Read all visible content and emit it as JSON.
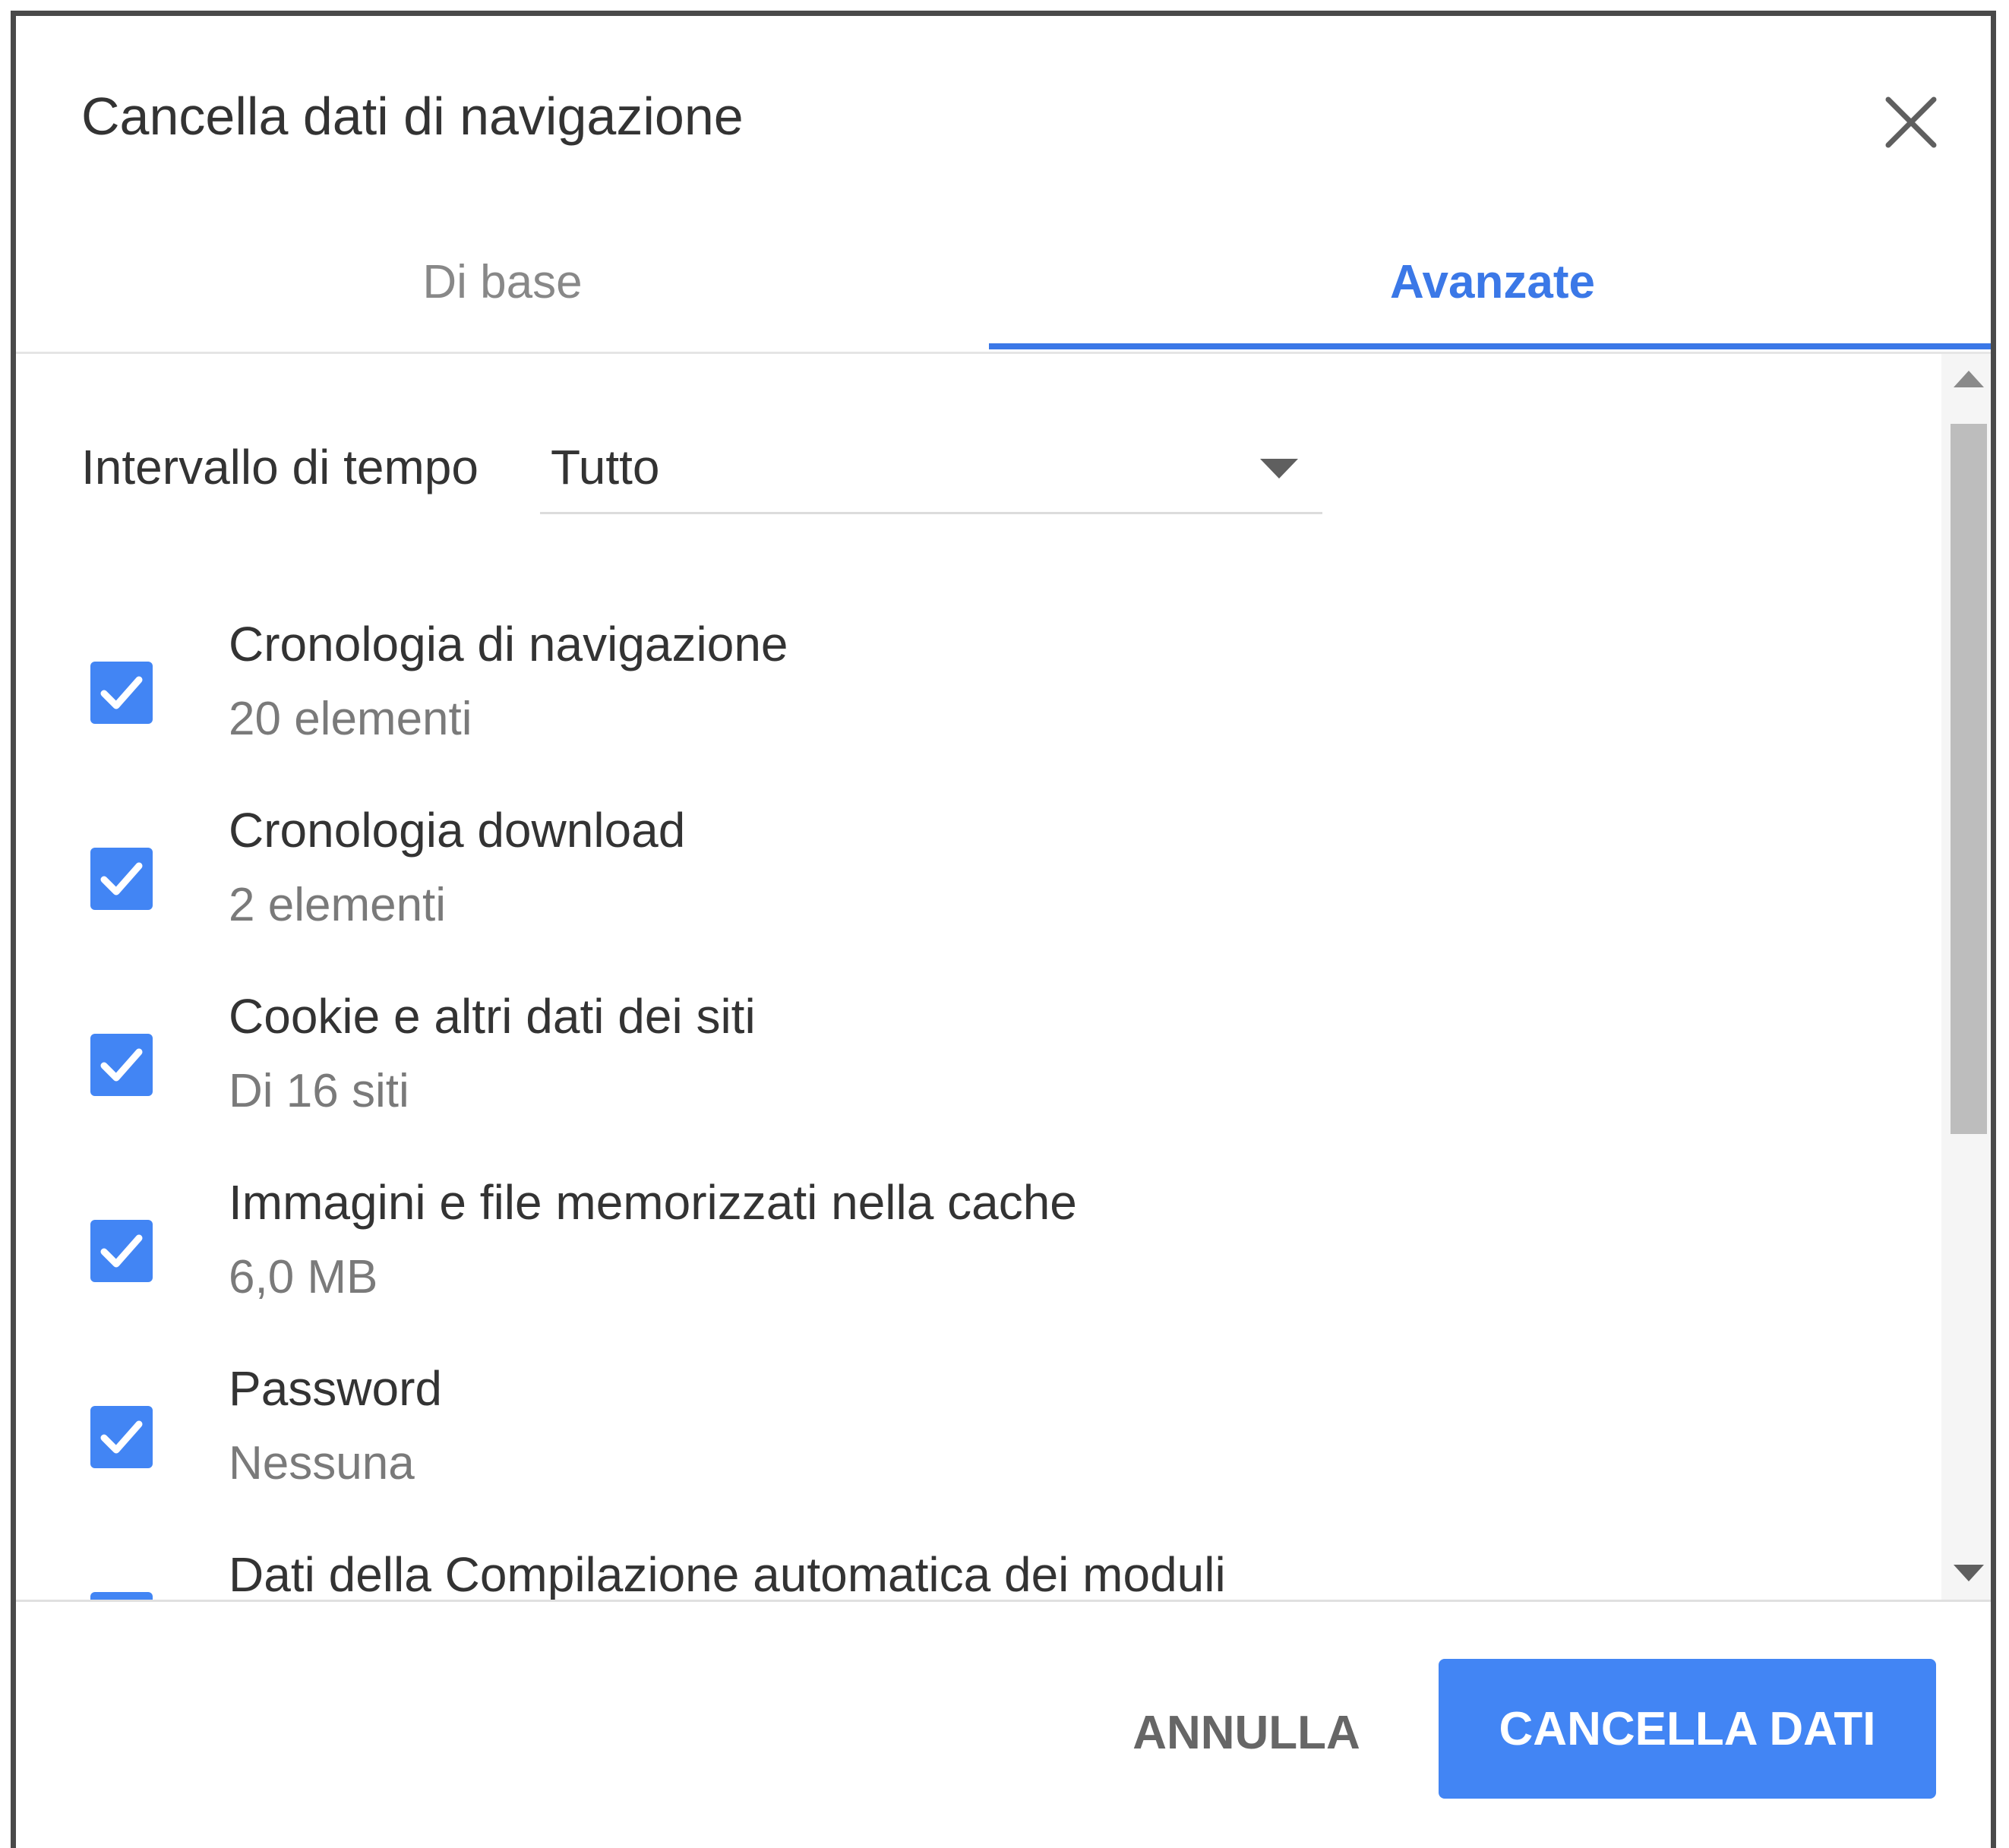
{
  "dialog": {
    "title": "Cancella dati di navigazione"
  },
  "tabs": [
    {
      "label": "Di base",
      "active": false
    },
    {
      "label": "Avanzate",
      "active": true
    }
  ],
  "time_range": {
    "label": "Intervallo di tempo",
    "value": "Tutto"
  },
  "items": [
    {
      "label": "Cronologia di navigazione",
      "sub": "20 elementi",
      "checked": true
    },
    {
      "label": "Cronologia download",
      "sub": "2 elementi",
      "checked": true
    },
    {
      "label": "Cookie e altri dati dei siti",
      "sub": "Di 16 siti",
      "checked": true
    },
    {
      "label": "Immagini e file memorizzati nella cache",
      "sub": "6,0 MB",
      "checked": true
    },
    {
      "label": "Password",
      "sub": "Nessuna",
      "checked": true
    },
    {
      "label": "Dati della Compilazione automatica dei moduli",
      "checked": true
    }
  ],
  "footer": {
    "cancel_label": "ANNULLA",
    "clear_label": "CANCELLA DATI"
  },
  "colors": {
    "accent": "#4285f4",
    "tab_active": "#3b78e7",
    "text": "#333333",
    "subtext": "#7a7a7a"
  },
  "icons": {
    "close": "close-icon",
    "dropdown": "dropdown-arrow-icon",
    "check": "checkmark-icon",
    "scroll_up": "scroll-up-arrow-icon",
    "scroll_down": "scroll-down-arrow-icon"
  }
}
